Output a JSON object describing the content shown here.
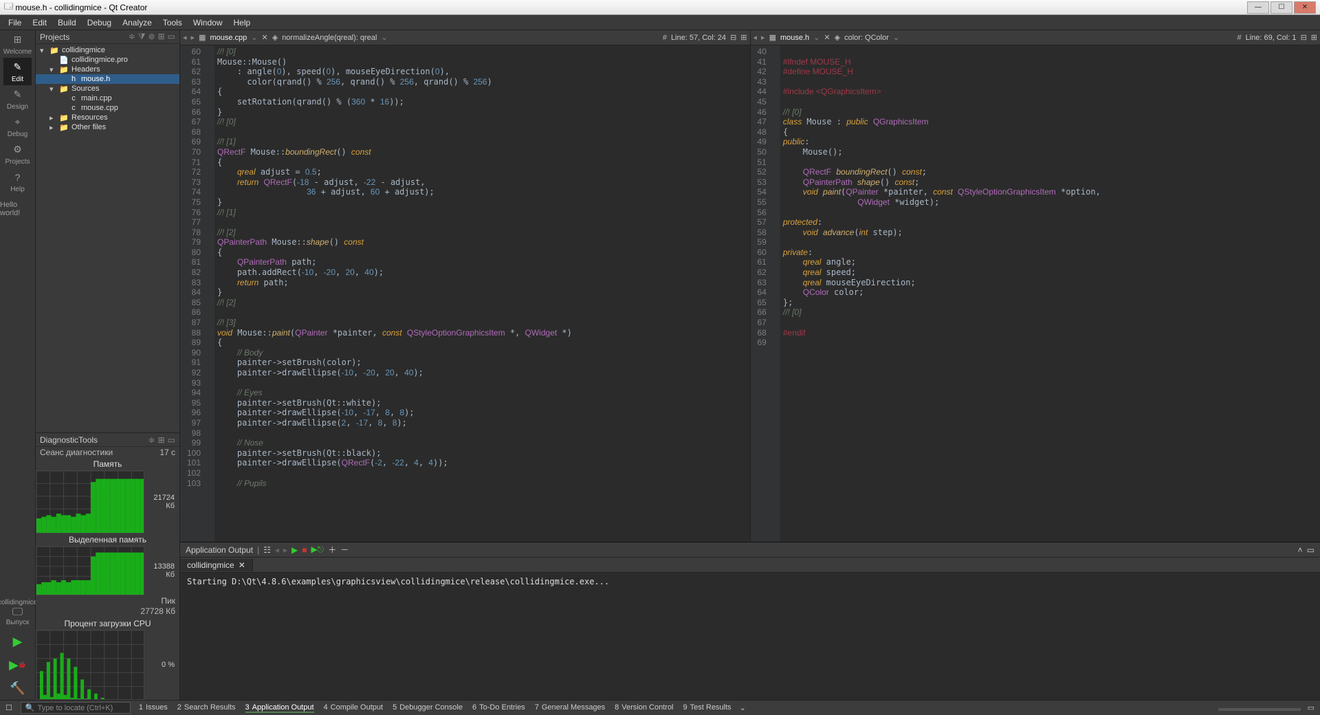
{
  "window": {
    "title": "mouse.h - collidingmice - Qt Creator"
  },
  "menus": [
    "File",
    "Edit",
    "Build",
    "Debug",
    "Analyze",
    "Tools",
    "Window",
    "Help"
  ],
  "modes": [
    {
      "name": "welcome",
      "label": "Welcome",
      "icon": "⊞"
    },
    {
      "name": "edit",
      "label": "Edit",
      "icon": "✎",
      "active": true
    },
    {
      "name": "design",
      "label": "Design",
      "icon": "✎"
    },
    {
      "name": "debug",
      "label": "Debug",
      "icon": "⌖"
    },
    {
      "name": "projects",
      "label": "Projects",
      "icon": "⚙"
    },
    {
      "name": "help",
      "label": "Help",
      "icon": "?"
    }
  ],
  "user_message": "Hello world!",
  "kit": {
    "project": "collidingmice",
    "target": "Выпуск",
    "icon": "🖵"
  },
  "projects_panel": {
    "title": "Projects",
    "tree": [
      {
        "depth": 0,
        "arrow": "▾",
        "icon": "📁",
        "label": "collidingmice"
      },
      {
        "depth": 1,
        "arrow": "",
        "icon": "📄",
        "label": "collidingmice.pro"
      },
      {
        "depth": 1,
        "arrow": "▾",
        "icon": "📁",
        "label": "Headers"
      },
      {
        "depth": 2,
        "arrow": "",
        "icon": "h",
        "label": "mouse.h",
        "selected": true
      },
      {
        "depth": 1,
        "arrow": "▾",
        "icon": "📁",
        "label": "Sources"
      },
      {
        "depth": 2,
        "arrow": "",
        "icon": "c",
        "label": "main.cpp"
      },
      {
        "depth": 2,
        "arrow": "",
        "icon": "c",
        "label": "mouse.cpp"
      },
      {
        "depth": 1,
        "arrow": "▸",
        "icon": "📁",
        "label": "Resources"
      },
      {
        "depth": 1,
        "arrow": "▸",
        "icon": "📁",
        "label": "Other files"
      }
    ]
  },
  "diagnostic": {
    "title": "DiagnosticTools",
    "session": "Сеанс диагностики",
    "session_time": "17 c",
    "memory_title": "Память",
    "alloc_title": "Выделенная память",
    "cpu_title": "Процент загрузки CPU",
    "mem_value": "21724 Кб",
    "alloc_value": "13388 Кб",
    "cpu_value": "0 %",
    "peak_label": "Пик",
    "peak_value": "27728 Кб"
  },
  "chart_data": [
    {
      "type": "area",
      "title": "Память",
      "values": [
        10,
        11,
        12,
        11,
        13,
        12,
        12,
        11,
        13,
        12,
        13,
        33,
        35,
        35,
        35,
        35,
        35,
        35,
        35,
        35,
        35,
        35
      ],
      "ylim": [
        0,
        40
      ],
      "ylabel": "Кб"
    },
    {
      "type": "area",
      "title": "Выделенная память",
      "values": [
        6,
        7,
        7,
        8,
        7,
        8,
        7,
        8,
        8,
        8,
        8,
        20,
        22,
        22,
        22,
        22,
        22,
        22,
        22,
        22,
        22,
        22
      ],
      "ylim": [
        0,
        25
      ],
      "ylabel": "Кб"
    },
    {
      "type": "area",
      "title": "Процент загрузки CPU",
      "values": [
        2,
        42,
        8,
        55,
        5,
        60,
        10,
        68,
        8,
        60,
        4,
        48,
        3,
        30,
        3,
        16,
        2,
        10,
        1,
        4,
        1,
        2,
        1,
        1,
        1,
        1,
        1,
        1,
        1,
        1,
        1,
        1
      ],
      "ylim": [
        0,
        100
      ],
      "ylabel": "%"
    }
  ],
  "editor_left": {
    "file": "mouse.cpp",
    "symbol": "normalizeAngle(qreal): qreal",
    "pos": "Line: 57, Col: 24",
    "start_line": 60,
    "lines": [
      "<span class='cm'>//! [0]</span>",
      "Mouse::Mouse()",
      "    : angle(<span class='num'>0</span>), speed(<span class='num'>0</span>), mouseEyeDirection(<span class='num'>0</span>),",
      "      color(qrand() % <span class='num'>256</span>, qrand() % <span class='num'>256</span>, qrand() % <span class='num'>256</span>)",
      "{",
      "    setRotation(qrand() % (<span class='num'>360</span> * <span class='num'>16</span>));",
      "}",
      "<span class='cm'>//! [0]</span>",
      "",
      "<span class='cm'>//! [1]</span>",
      "<span class='ty'>QRectF</span> Mouse::<span class='fn'>boundingRect</span>() <span class='kw'>const</span>",
      "{",
      "    <span class='kw'>qreal</span> adjust = <span class='num'>0.5</span>;",
      "    <span class='kw'>return</span> <span class='ty'>QRectF</span>(<span class='num'>-18</span> - adjust, <span class='num'>-22</span> - adjust,",
      "                  <span class='num'>36</span> + adjust, <span class='num'>60</span> + adjust);",
      "}",
      "<span class='cm'>//! [1]</span>",
      "",
      "<span class='cm'>//! [2]</span>",
      "<span class='ty'>QPainterPath</span> Mouse::<span class='fn'>shape</span>() <span class='kw'>const</span>",
      "{",
      "    <span class='ty'>QPainterPath</span> path;",
      "    path.addRect(<span class='num'>-10</span>, <span class='num'>-20</span>, <span class='num'>20</span>, <span class='num'>40</span>);",
      "    <span class='kw'>return</span> path;",
      "}",
      "<span class='cm'>//! [2]</span>",
      "",
      "<span class='cm'>//! [3]</span>",
      "<span class='kw'>void</span> Mouse::<span class='fn'>paint</span>(<span class='ty'>QPainter</span> *painter, <span class='kw'>const</span> <span class='ty'>QStyleOptionGraphicsItem</span> *, <span class='ty'>QWidget</span> *)",
      "{",
      "    <span class='cm'>// Body</span>",
      "    painter-&gt;setBrush(color);",
      "    painter-&gt;drawEllipse(<span class='num'>-10</span>, <span class='num'>-20</span>, <span class='num'>20</span>, <span class='num'>40</span>);",
      "",
      "    <span class='cm'>// Eyes</span>",
      "    painter-&gt;setBrush(Qt::white);",
      "    painter-&gt;drawEllipse(<span class='num'>-10</span>, <span class='num'>-17</span>, <span class='num'>8</span>, <span class='num'>8</span>);",
      "    painter-&gt;drawEllipse(<span class='num'>2</span>, <span class='num'>-17</span>, <span class='num'>8</span>, <span class='num'>8</span>);",
      "",
      "    <span class='cm'>// Nose</span>",
      "    painter-&gt;setBrush(Qt::black);",
      "    painter-&gt;drawEllipse(<span class='ty'>QRectF</span>(<span class='num'>-2</span>, <span class='num'>-22</span>, <span class='num'>4</span>, <span class='num'>4</span>));",
      "",
      "    <span class='cm'>// Pupils</span>"
    ]
  },
  "editor_right": {
    "file": "mouse.h",
    "symbol": "color: QColor",
    "pos": "Line: 69, Col: 1",
    "start_line": 40,
    "lines": [
      "",
      "<span class='pp'>#ifndef MOUSE_H</span>",
      "<span class='pp'>#define MOUSE_H</span>",
      "",
      "<span class='pp'>#include &lt;QGraphicsItem&gt;</span>",
      "",
      "<span class='cm'>//! [0]</span>",
      "<span class='kw'>class</span> Mouse : <span class='kw'>public</span> <span class='ty'>QGraphicsItem</span>",
      "{",
      "<span class='kw'>public</span>:",
      "    Mouse();",
      "",
      "    <span class='ty'>QRectF</span> <span class='fn'>boundingRect</span>() <span class='kw'>const</span>;",
      "    <span class='ty'>QPainterPath</span> <span class='fn'>shape</span>() <span class='kw'>const</span>;",
      "    <span class='kw'>void</span> <span class='fn'>paint</span>(<span class='ty'>QPainter</span> *painter, <span class='kw'>const</span> <span class='ty'>QStyleOptionGraphicsItem</span> *option,",
      "               <span class='ty'>QWidget</span> *widget);",
      "",
      "<span class='kw'>protected</span>:",
      "    <span class='kw'>void</span> <span class='fn'>advance</span>(<span class='kw'>int</span> step);",
      "",
      "<span class='kw'>private</span>:",
      "    <span class='kw'>qreal</span> angle;",
      "    <span class='kw'>qreal</span> speed;",
      "    <span class='kw'>qreal</span> mouseEyeDirection;",
      "    <span class='ty'>QColor</span> color;",
      "};",
      "<span class='cm'>//! [0]</span>",
      "",
      "<span class='pp'>#endif</span>",
      ""
    ]
  },
  "output": {
    "title": "Application Output",
    "tab": "collidingmice",
    "text": "Starting D:\\Qt\\4.8.6\\examples\\graphicsview\\collidingmice\\release\\collidingmice.exe..."
  },
  "statusbar": {
    "locate_ph": "Type to locate (Ctrl+K)",
    "tabs": [
      {
        "n": "1",
        "l": "Issues"
      },
      {
        "n": "2",
        "l": "Search Results"
      },
      {
        "n": "3",
        "l": "Application Output",
        "active": true
      },
      {
        "n": "4",
        "l": "Compile Output"
      },
      {
        "n": "5",
        "l": "Debugger Console"
      },
      {
        "n": "6",
        "l": "To-Do Entries"
      },
      {
        "n": "7",
        "l": "General Messages"
      },
      {
        "n": "8",
        "l": "Version Control"
      },
      {
        "n": "9",
        "l": "Test Results"
      }
    ]
  }
}
